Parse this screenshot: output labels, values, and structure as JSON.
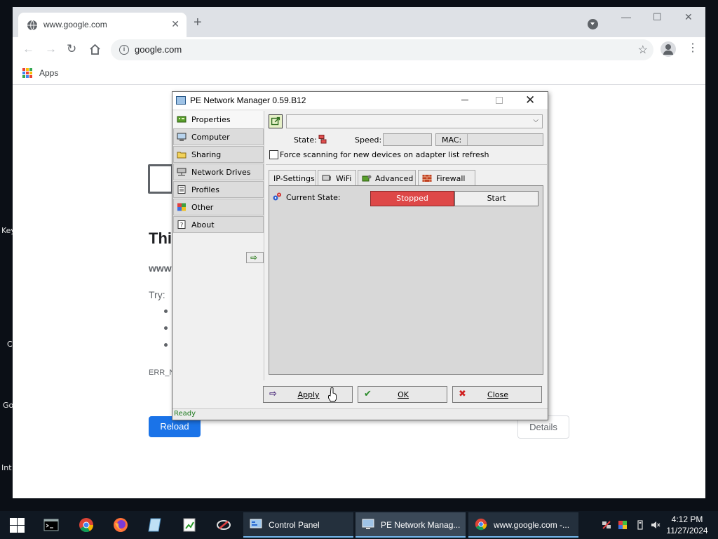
{
  "desktop": {
    "fragments": [
      "Key",
      "C",
      "Go",
      "Int"
    ]
  },
  "browser": {
    "tab_title": "www.google.com",
    "new_tab_label": "+",
    "url": "google.com",
    "bookmarks": {
      "apps_label": "Apps"
    },
    "page": {
      "title_fragment": "Thi",
      "host_fragment": "www",
      "try_label": "Try:",
      "error_code_fragment": "ERR_N",
      "reload_label": "Reload",
      "details_label": "Details"
    }
  },
  "dialog": {
    "title": "PE Network Manager 0.59.B12",
    "sidebar": [
      {
        "label": "Properties",
        "active": true
      },
      {
        "label": "Computer"
      },
      {
        "label": "Sharing"
      },
      {
        "label": "Network Drives"
      },
      {
        "label": "Profiles"
      },
      {
        "label": "Other"
      },
      {
        "label": "About"
      }
    ],
    "state_label": "State:",
    "speed_label": "Speed:",
    "mac_label": "MAC:",
    "force_scan_label": "Force scanning for new devices on adapter list refresh",
    "tabs": [
      {
        "label": "IP-Settings"
      },
      {
        "label": "WiFi"
      },
      {
        "label": "Advanced",
        "active": true
      },
      {
        "label": "Firewall"
      }
    ],
    "current_state_label": "Current State:",
    "state_value": "Stopped",
    "start_label": "Start",
    "buttons": {
      "apply": "Apply",
      "ok": "OK",
      "close": "Close"
    },
    "status": "Ready"
  },
  "taskbar": {
    "tasks": [
      {
        "label": "Control Panel"
      },
      {
        "label": "PE Network Manag...",
        "active": true
      },
      {
        "label": "www.google.com -..."
      }
    ],
    "time": "4:12 PM",
    "date": "11/27/2024"
  },
  "colors": {
    "chrome_tabstrip": "#dee1e6",
    "reload_blue": "#1a73e8",
    "stopped_red": "#de4848",
    "taskbar": "#101822",
    "status_green": "#1e7a1e"
  }
}
